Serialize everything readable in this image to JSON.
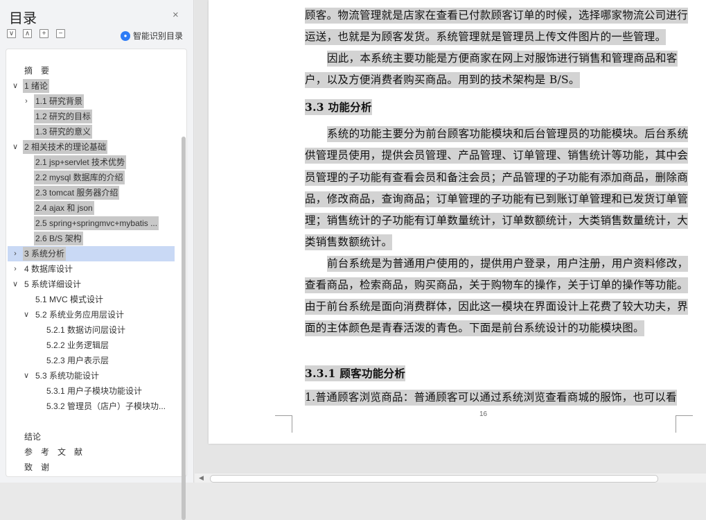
{
  "nav": {
    "title": "目录",
    "close": "×",
    "controls": [
      {
        "name": "collapse-all-button",
        "symbol": "∨"
      },
      {
        "name": "expand-level-button",
        "symbol": "∧"
      },
      {
        "name": "add-heading-button",
        "symbol": "+"
      },
      {
        "name": "remove-heading-button",
        "symbol": "−"
      }
    ],
    "smart_toc": "智能识别目录",
    "toc": [
      {
        "label": "摘　要",
        "arrow": "",
        "level": 0,
        "hl": false
      },
      {
        "label": "1  绪论",
        "arrow": "∨",
        "level": 0,
        "hl": true
      },
      {
        "label": "1.1  研究背景",
        "arrow": "›",
        "level": 1,
        "hl": true
      },
      {
        "label": "1.2 研究的目标",
        "arrow": "",
        "level": 1,
        "hl": true
      },
      {
        "label": "1.3 研究的意义",
        "arrow": "",
        "level": 1,
        "hl": true
      },
      {
        "label": "2 相关技术的理论基础",
        "arrow": "∨",
        "level": 0,
        "hl": true
      },
      {
        "label": "2.1 jsp+servlet 技术优势",
        "arrow": "",
        "level": 1,
        "hl": true
      },
      {
        "label": "2.2 mysql 数据库的介绍",
        "arrow": "",
        "level": 1,
        "hl": true
      },
      {
        "label": "2.3 tomcat 服务器介绍",
        "arrow": "",
        "level": 1,
        "hl": true
      },
      {
        "label": "2.4 ajax 和 json",
        "arrow": "",
        "level": 1,
        "hl": true
      },
      {
        "label": "2.5 spring+springmvc+mybatis ...",
        "arrow": "",
        "level": 1,
        "hl": true
      },
      {
        "label": "2.6 B/S 架构",
        "arrow": "",
        "level": 1,
        "hl": true
      },
      {
        "label": "3  系统分析",
        "arrow": "›",
        "level": 0,
        "hl": true
      },
      {
        "label": "4  数据库设计",
        "arrow": "›",
        "level": 0,
        "hl": false
      },
      {
        "label": "5  系统详细设计",
        "arrow": "∨",
        "level": 0,
        "hl": false
      },
      {
        "label": "5.1 MVC 模式设计",
        "arrow": "",
        "level": 1,
        "hl": false
      },
      {
        "label": "5.2  系统业务应用层设计",
        "arrow": "∨",
        "level": 1,
        "hl": false
      },
      {
        "label": "5.2.1  数据访问层设计",
        "arrow": "",
        "level": 2,
        "hl": false
      },
      {
        "label": "5.2.2 业务逻辑层",
        "arrow": "",
        "level": 2,
        "hl": false
      },
      {
        "label": "5.2.3 用户表示层",
        "arrow": "",
        "level": 2,
        "hl": false
      },
      {
        "label": "5.3  系统功能设计",
        "arrow": "∨",
        "level": 1,
        "hl": false
      },
      {
        "label": "5.3.1 用户子模块功能设计",
        "arrow": "",
        "level": 2,
        "hl": false
      },
      {
        "label": "5.3.2 管理员（店户）子模块功...",
        "arrow": "",
        "level": 2,
        "hl": false
      },
      {
        "label": "结论",
        "arrow": "",
        "level": 0,
        "hl": false
      },
      {
        "label": "参　考　文　献",
        "arrow": "",
        "level": 0,
        "hl": false
      },
      {
        "label": "致　谢",
        "arrow": "",
        "level": 0,
        "hl": false
      }
    ],
    "selected_index": 12
  },
  "doc": {
    "page_number": "16",
    "lines": [
      {
        "text": "顾客。物流管理就是店家在查看已付款顾客订单的时候，选择哪家物流公司进行",
        "indent": false,
        "heading": false
      },
      {
        "text": "运送，也就是为顾客发货。系统管理就是管理员上传文件图片的一些管理。",
        "indent": false,
        "heading": false
      },
      {
        "text": "因此，本系统主要功能是方便商家在网上对服饰进行销售和管理商品和客",
        "indent": true,
        "heading": false
      },
      {
        "text": "户，以及方便消费者购买商品。用到的技术架构是 B/S。",
        "indent": false,
        "heading": false
      },
      {
        "text": " 3.3 功能分析",
        "indent": false,
        "heading": true
      },
      {
        "text": "系统的功能主要分为前台顾客功能模块和后台管理员的功能模块。后台系统",
        "indent": true,
        "heading": false
      },
      {
        "text": "供管理员使用，提供会员管理、产品管理、订单管理、销售统计等功能，其中会",
        "indent": false,
        "heading": false
      },
      {
        "text": "员管理的子功能有查看会员和备注会员；产品管理的子功能有添加商品，删除商",
        "indent": false,
        "heading": false
      },
      {
        "text": "品，修改商品，查询商品；订单管理的子功能有已到账订单管理和已发货订单管",
        "indent": false,
        "heading": false
      },
      {
        "text": "理；销售统计的子功能有订单数量统计，订单数额统计，大类销售数量统计，大",
        "indent": false,
        "heading": false
      },
      {
        "text": "类销售数额统计。",
        "indent": false,
        "heading": false
      },
      {
        "text": "前台系统是为普通用户使用的，提供用户登录，用户注册，用户资料修改，",
        "indent": true,
        "heading": false
      },
      {
        "text": "查看商品，检索商品，购买商品，关于购物车的操作，关于订单的操作等功能。",
        "indent": false,
        "heading": false
      },
      {
        "text": "由于前台系统是面向消费群体，因此这一模块在界面设计上花费了较大功夫，界",
        "indent": false,
        "heading": false
      },
      {
        "text": "面的主体颜色是青春活泼的青色。下面是前台系统设计的功能模块图。",
        "indent": false,
        "heading": false
      },
      {
        "text": "3.3.1 顾客功能分析",
        "indent": false,
        "heading": true
      },
      {
        "text": " 1.普通顾客浏览商品：普通顾客可以通过系统浏览查看商城的服饰，也可以看",
        "indent": false,
        "heading": false
      }
    ]
  }
}
